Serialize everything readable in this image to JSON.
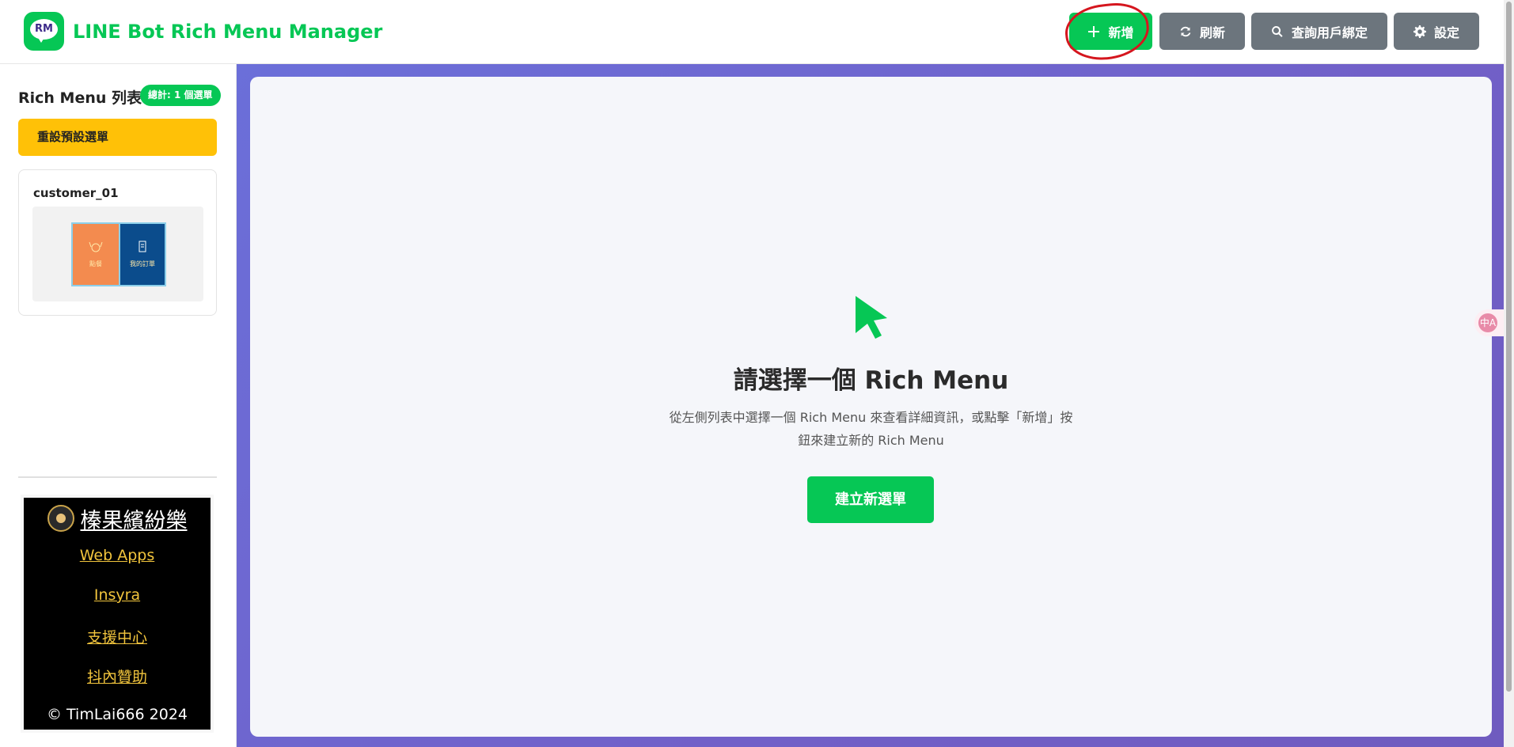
{
  "header": {
    "logo_text": "RM",
    "title": "LINE Bot Rich Menu Manager",
    "buttons": {
      "add": "新增",
      "refresh": "刷新",
      "query": "查詢用戶綁定",
      "settings": "設定"
    }
  },
  "sidebar": {
    "title": "Rich Menu 列表",
    "count_badge": "總計: 1 個選單",
    "reset_button": "重設預設選單",
    "menus": [
      {
        "name": "customer_01",
        "preview": {
          "left_label": "點餐",
          "right_label": "我的訂單",
          "left_color": "#f38b4f",
          "right_color": "#0b4c8c"
        }
      }
    ],
    "promo": {
      "title": "榛果繽紛樂",
      "links": [
        "Web Apps",
        "Insyra",
        "支援中心",
        "抖內贊助"
      ],
      "copyright": "© TimLai666 2024"
    }
  },
  "main": {
    "empty_icon": "mouse-pointer-icon",
    "empty_title": "請選擇一個 Rich Menu",
    "empty_description": "從左側列表中選擇一個 Rich Menu 來查看詳細資訊，或點擊「新增」按鈕來建立新的 Rich Menu",
    "create_button": "建立新選單"
  },
  "floating_widget": {
    "icon": "translate-icon",
    "label": "中A"
  },
  "colors": {
    "brand_green": "#06c755",
    "secondary_gray": "#6c757d",
    "warning_yellow": "#ffc107",
    "gradient_start": "#6b6fd9",
    "gradient_end": "#6f5bbf",
    "annotation_red": "#d5161e"
  }
}
